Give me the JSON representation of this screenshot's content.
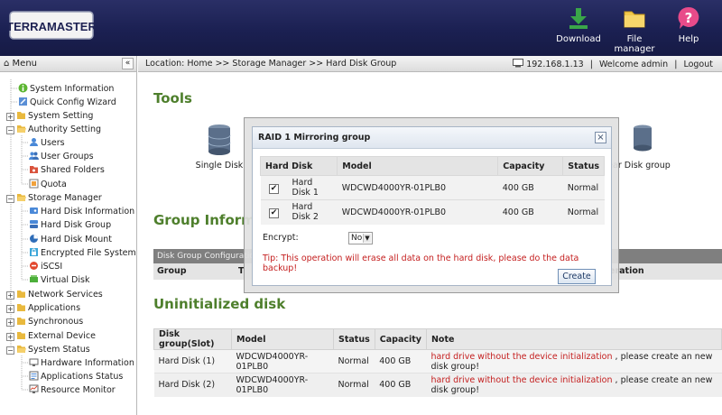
{
  "header": {
    "logo_text": "TERRAMASTER",
    "buttons": [
      {
        "label": "Download",
        "icon": "download-icon",
        "color": "#2ea043"
      },
      {
        "label": "File manager",
        "icon": "folder-icon",
        "color": "#f2c94c"
      },
      {
        "label": "Help",
        "icon": "help-icon",
        "color": "#e83e8c"
      }
    ]
  },
  "menu": {
    "title": "Menu",
    "collapse_label": "«",
    "items": [
      {
        "label": "System Information",
        "icon": "info-icon"
      },
      {
        "label": "Quick Config Wizard",
        "icon": "wizard-icon"
      },
      {
        "label": "System Setting",
        "icon": "folder-icon"
      },
      {
        "label": "Authority Setting",
        "icon": "folder-icon"
      },
      {
        "label": "Users",
        "icon": "user-icon"
      },
      {
        "label": "User Groups",
        "icon": "users-icon"
      },
      {
        "label": "Shared Folders",
        "icon": "shared-folder-icon"
      },
      {
        "label": "Quota",
        "icon": "quota-icon"
      },
      {
        "label": "Storage Manager",
        "icon": "folder-icon"
      },
      {
        "label": "Hard Disk Information",
        "icon": "disk-info-icon"
      },
      {
        "label": "Hard Disk Group",
        "icon": "disk-group-icon"
      },
      {
        "label": "Hard Disk Mount",
        "icon": "disk-mount-icon"
      },
      {
        "label": "Encrypted File System",
        "icon": "encrypt-icon"
      },
      {
        "label": "iSCSI",
        "icon": "iscsi-icon"
      },
      {
        "label": "Virtual Disk",
        "icon": "virtual-disk-icon"
      },
      {
        "label": "Network Services",
        "icon": "folder-icon"
      },
      {
        "label": "Applications",
        "icon": "folder-icon"
      },
      {
        "label": "Synchronous",
        "icon": "folder-icon"
      },
      {
        "label": "External Device",
        "icon": "folder-icon"
      },
      {
        "label": "System Status",
        "icon": "folder-icon"
      },
      {
        "label": "Hardware Information",
        "icon": "hardware-icon"
      },
      {
        "label": "Applications Status",
        "icon": "app-status-icon"
      },
      {
        "label": "Resource Monitor",
        "icon": "monitor-icon"
      }
    ]
  },
  "location": {
    "path": "Location: Home >> Storage Manager >> Hard Disk Group",
    "ip": "192.168.1.13",
    "welcome": "Welcome admin",
    "logout": "Logout"
  },
  "tools": {
    "title": "Tools",
    "items": [
      {
        "label": "Single Disk"
      },
      {
        "label": "ear Disk group"
      }
    ]
  },
  "group_info": {
    "title": "Group Inform",
    "config_caption": "Disk Group Configuratio",
    "col_group": "Group",
    "col_t": "T",
    "col_operation": "eration"
  },
  "uninit": {
    "title": "Uninitialized disk",
    "columns": [
      "Disk group(Slot)",
      "Model",
      "Status",
      "Capacity",
      "Note"
    ],
    "rows": [
      {
        "slot": "Hard Disk (1)",
        "model": "WDCWD4000YR-01PLB0",
        "status": "Normal",
        "capacity": "400 GB",
        "note_warn": "hard drive without the device initialization",
        "note_rest": ", please create an new disk group!"
      },
      {
        "slot": "Hard Disk (2)",
        "model": "WDCWD4000YR-01PLB0",
        "status": "Normal",
        "capacity": "400 GB",
        "note_warn": "hard drive without the device initialization",
        "note_rest": ", please create an new disk group!"
      }
    ]
  },
  "dialog": {
    "title": "RAID 1 Mirroring group",
    "close_label": "×",
    "columns": [
      "Hard Disk",
      "Model",
      "Capacity",
      "Status"
    ],
    "rows": [
      {
        "checked": "✔",
        "disk": "Hard Disk 1",
        "model": "WDCWD4000YR-01PLB0",
        "capacity": "400 GB",
        "status": "Normal"
      },
      {
        "checked": "✔",
        "disk": "Hard Disk 2",
        "model": "WDCWD4000YR-01PLB0",
        "capacity": "400 GB",
        "status": "Normal"
      }
    ],
    "encrypt_label": "Encrypt:",
    "encrypt_value": "No",
    "tip": "Tip: This operation will erase all data on the hard disk, please do the data backup!",
    "create_label": "Create"
  }
}
